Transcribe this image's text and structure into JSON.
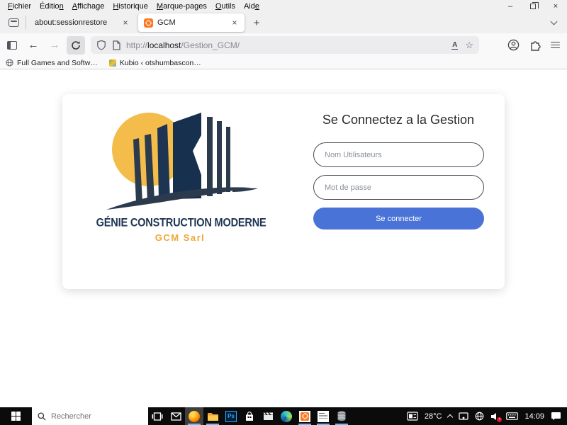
{
  "colors": {
    "accent_blue": "#4a73d8",
    "logo_navy": "#1d3553",
    "logo_gold": "#f4bd4b",
    "logo_orange": "#eda836",
    "running_indicator": "#76b9ed",
    "xampp_orange": "#fb7a24"
  },
  "menu_bar": {
    "items": [
      {
        "pre": "",
        "key": "F",
        "post": "ichier"
      },
      {
        "pre": "Éditio",
        "key": "n",
        "post": ""
      },
      {
        "pre": "",
        "key": "A",
        "post": "ffichage"
      },
      {
        "pre": "",
        "key": "H",
        "post": "istorique"
      },
      {
        "pre": "",
        "key": "M",
        "post": "arque-pages"
      },
      {
        "pre": "",
        "key": "O",
        "post": "utils"
      },
      {
        "pre": "Aid",
        "key": "e",
        "post": ""
      }
    ]
  },
  "window_controls": {
    "minimize": "–",
    "close": "×"
  },
  "tab_bar": {
    "tab1_title": "about:sessionrestore",
    "tab2_title": "GCM",
    "close_glyph": "×",
    "new_tab_glyph": "+"
  },
  "navigation": {
    "back_glyph": "←",
    "forward_glyph": "→",
    "url_scheme": "http://",
    "url_host": "localhost",
    "url_path": "/Gestion_GCM/",
    "star_glyph": "☆",
    "translate_glyph": "A"
  },
  "bookmarks_bar": {
    "item1": "Full Games and Softw…",
    "item2": "Kubio ‹ otshumbascon…"
  },
  "page": {
    "heading": "Se Connectez a la Gestion",
    "username_placeholder": "Nom Utilisateurs",
    "password_placeholder": "Mot de passe",
    "submit_label": "Se connecter",
    "logo_line1": "GÉNIE CONSTRUCTION MODERNE",
    "logo_line2": "GCM Sarl"
  },
  "taskbar": {
    "search_placeholder": "Rechercher",
    "ps_label": "Ps",
    "temperature": "28°C",
    "time": "14:09"
  }
}
